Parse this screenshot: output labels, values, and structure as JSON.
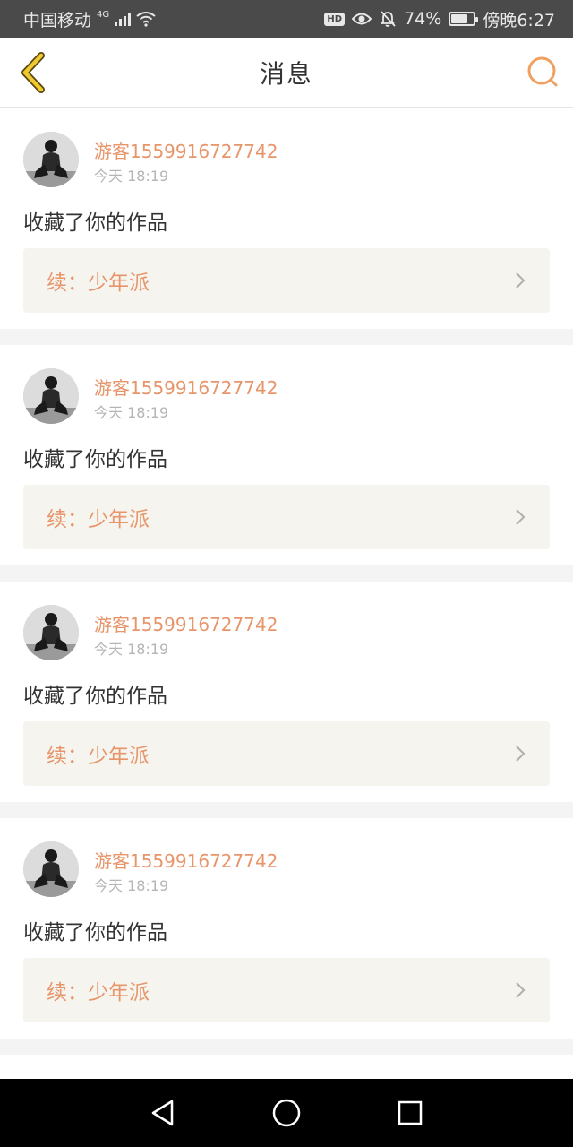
{
  "status_bar": {
    "carrier": "中国移动",
    "network": "4G",
    "battery_pct": "74%",
    "battery_level": 0.74,
    "time": "傍晚6:27",
    "icons": [
      "signal-icon",
      "wifi-icon",
      "hd-icon",
      "eye-icon",
      "bell-off-icon",
      "battery-icon"
    ]
  },
  "header": {
    "title": "消息",
    "back_icon": "chevron-left-icon",
    "search_icon": "search-icon",
    "accent_color": "#e7956a"
  },
  "messages": [
    {
      "user": "游客1559916727742",
      "time": "今天 18:19",
      "action": "收藏了你的作品",
      "work": "续：少年派"
    },
    {
      "user": "游客1559916727742",
      "time": "今天 18:19",
      "action": "收藏了你的作品",
      "work": "续：少年派"
    },
    {
      "user": "游客1559916727742",
      "time": "今天 18:19",
      "action": "收藏了你的作品",
      "work": "续：少年派"
    },
    {
      "user": "游客1559916727742",
      "time": "今天 18:19",
      "action": "收藏了你的作品",
      "work": "续：少年派"
    }
  ],
  "nav_bar": {
    "icons": [
      "back-triangle-icon",
      "home-circle-icon",
      "recents-square-icon"
    ]
  }
}
